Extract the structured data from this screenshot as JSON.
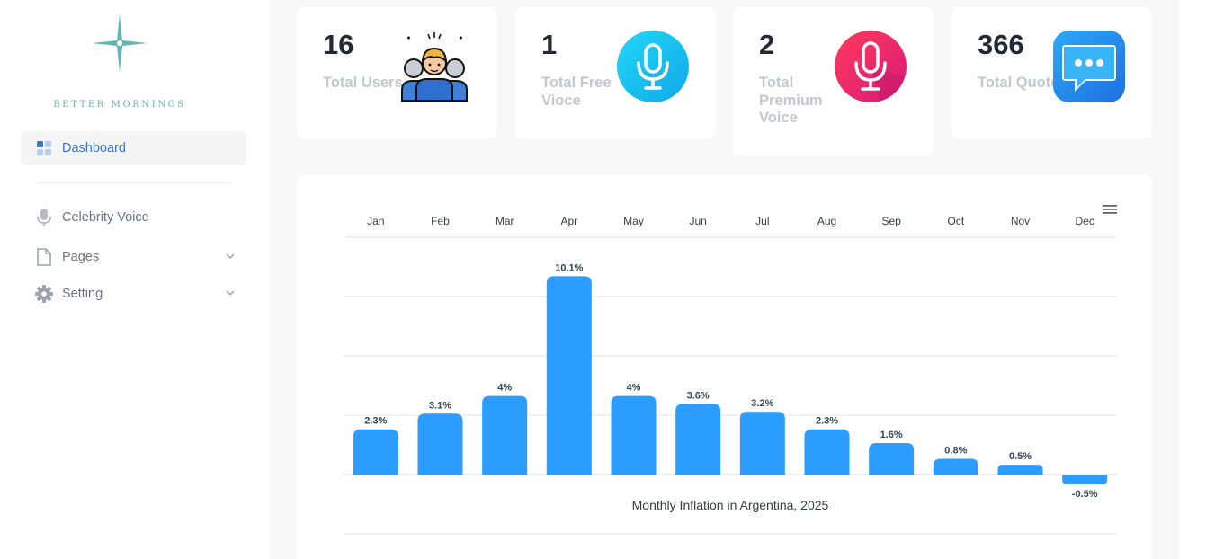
{
  "sidebar": {
    "logo_text": "BETTER MORNINGS",
    "items": [
      {
        "label": "Dashboard",
        "icon": "dashboard-icon",
        "active": true
      },
      {
        "label": "Celebrity Voice",
        "icon": "microphone-icon"
      },
      {
        "label": "Pages",
        "icon": "document-icon",
        "expandable": true
      },
      {
        "label": "Setting",
        "icon": "gear-icon",
        "expandable": true
      }
    ]
  },
  "stats": [
    {
      "value": "16",
      "label": "Total Users",
      "icon": "users-group-icon"
    },
    {
      "value": "1",
      "label": "Total Free Vioce",
      "icon": "microphone-cyan-icon"
    },
    {
      "value": "2",
      "label": "Total Premium Voice",
      "icon": "microphone-red-icon"
    },
    {
      "value": "366",
      "label": "Total Quote",
      "icon": "chat-bubble-icon"
    }
  ],
  "colors": {
    "accent": "#3a73d8",
    "bar": "#2a9dff",
    "logo": "#5fb6b6",
    "free_voice_icon": "#18c6f0",
    "premium_voice_icon": "#f03060",
    "quote_icon": "#2a8ef0"
  },
  "chart_data": {
    "type": "bar",
    "title": "Monthly Inflation in Argentina, 2025",
    "categories": [
      "Jan",
      "Feb",
      "Mar",
      "Apr",
      "May",
      "Jun",
      "Jul",
      "Aug",
      "Sep",
      "Oct",
      "Nov",
      "Dec"
    ],
    "values": [
      2.3,
      3.1,
      4,
      10.1,
      4,
      3.6,
      3.2,
      2.3,
      1.6,
      0.8,
      0.5,
      -0.5
    ],
    "value_labels": [
      "2.3%",
      "3.1%",
      "4%",
      "10.1%",
      "4%",
      "3.6%",
      "3.2%",
      "2.3%",
      "1.6%",
      "0.8%",
      "0.5%",
      "-0.5%"
    ],
    "xaxis_position": "top",
    "yaxis_visible": false,
    "grid": true,
    "ylim": [
      -0.5,
      12
    ]
  }
}
